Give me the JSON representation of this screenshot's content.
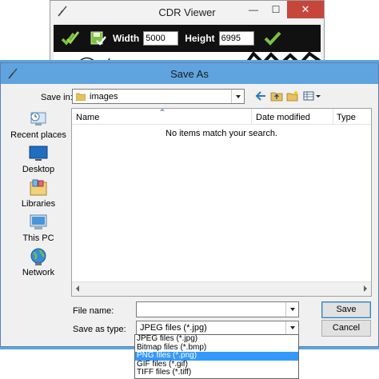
{
  "cdr_window": {
    "title": "CDR Viewer",
    "minimize": "—",
    "maximize": "☐",
    "close": "✕",
    "width_label": "Width",
    "width_value": "5000",
    "height_label": "Height",
    "height_value": "6995"
  },
  "dialog": {
    "title": "Save As",
    "save_in_label": "Save in:",
    "save_in_value": "images",
    "places": [
      {
        "label": "Recent places",
        "icon": "recent-places-icon"
      },
      {
        "label": "Desktop",
        "icon": "desktop-icon"
      },
      {
        "label": "Libraries",
        "icon": "libraries-icon"
      },
      {
        "label": "This PC",
        "icon": "this-pc-icon"
      },
      {
        "label": "Network",
        "icon": "network-icon"
      }
    ],
    "columns": [
      "Name",
      "Date modified",
      "Type"
    ],
    "empty_message": "No items match your search.",
    "file_name_label": "File name:",
    "file_name_value": "",
    "save_as_type_label": "Save as type:",
    "save_as_type_value": "JPEG files (*.jpg)",
    "save_button": "Save",
    "cancel_button": "Cancel",
    "type_options": [
      {
        "label": "JPEG files (*.jpg)",
        "selected": false
      },
      {
        "label": "Bitmap files (*.bmp)",
        "selected": false
      },
      {
        "label": "PNG files (*.png)",
        "selected": true
      },
      {
        "label": "GIF files (*.gif)",
        "selected": false
      },
      {
        "label": "TIFF files (*.tiff)",
        "selected": false
      }
    ],
    "colors": {
      "title_bar": "#5fa4de",
      "selection": "#3399ff",
      "close_button": "#c7463c"
    }
  }
}
